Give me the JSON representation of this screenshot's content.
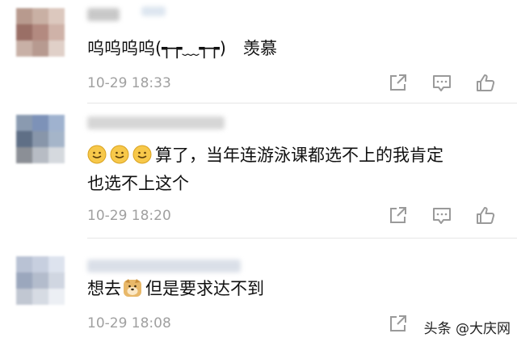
{
  "comments": [
    {
      "text": "呜呜呜呜(┭┮﹏┭┮)　羡慕",
      "time": "10-29 18:33"
    },
    {
      "text_line1": "算了，当年连游泳课都选不上的我肯定",
      "text_line2": "也选不上这个",
      "time": "10-29 18:20"
    },
    {
      "text_before": "想去",
      "text_after": "但是要求达不到",
      "time": "10-29 18:08"
    }
  ],
  "icons": [
    "share-icon",
    "comment-icon",
    "like-icon"
  ],
  "watermark": "头条 @大庆网",
  "colors": {
    "text": "#111111",
    "time": "#a0a0a0",
    "icon": "#9a9a9a",
    "divider": "#e6e6e6"
  }
}
